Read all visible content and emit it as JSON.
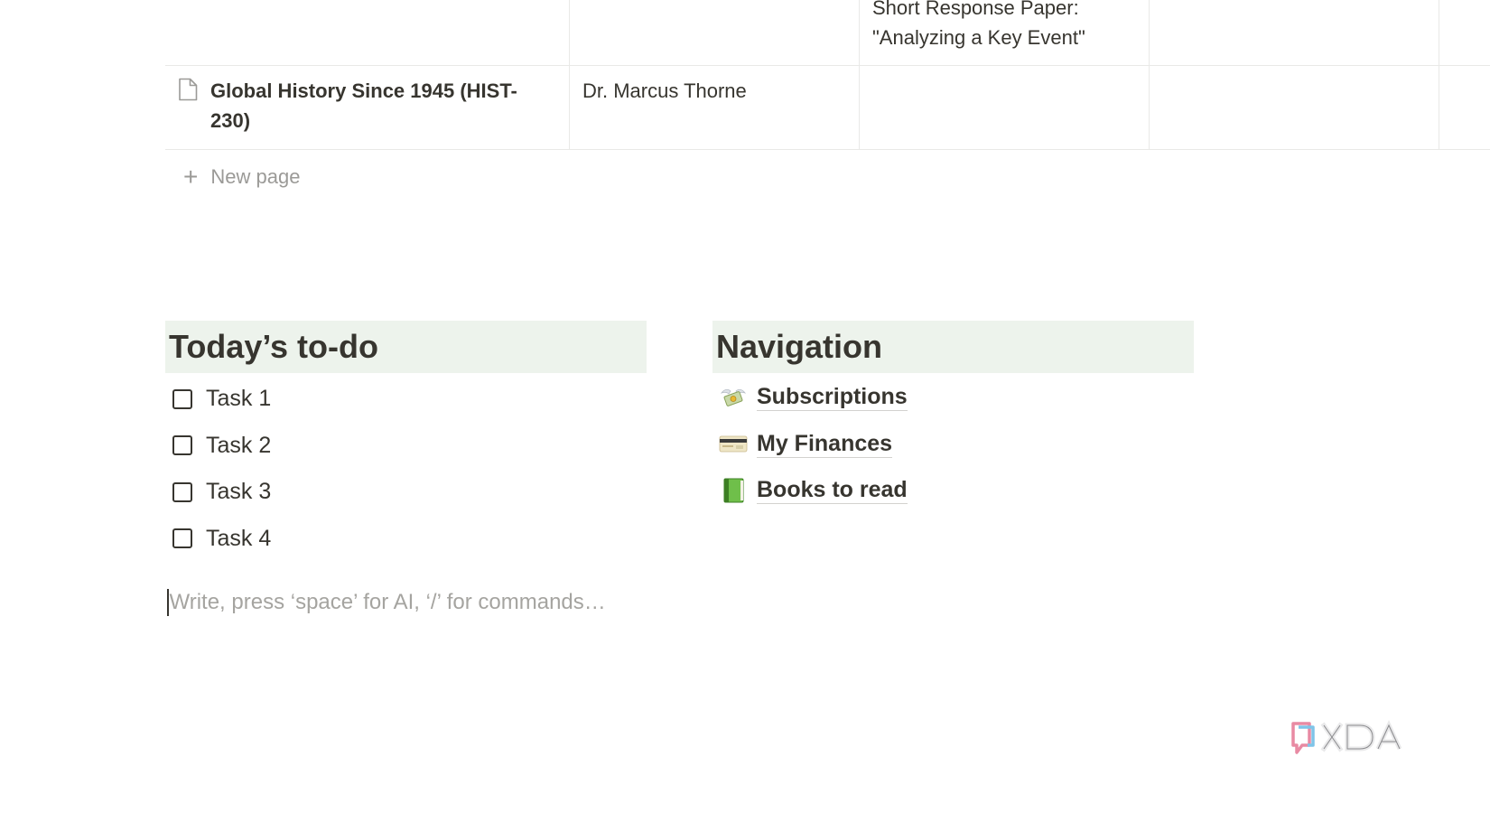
{
  "table": {
    "rows": [
      {
        "title": "",
        "instructor": "",
        "assignment_line1": "Short Response Paper:",
        "assignment_line2": "\"Analyzing a Key Event\""
      },
      {
        "title": "Global History Since 1945 (HIST-230)",
        "instructor": "Dr. Marcus Thorne",
        "assignment_line1": "",
        "assignment_line2": ""
      }
    ],
    "new_page_label": "New page"
  },
  "todo": {
    "heading": "Today’s to-do",
    "items": [
      {
        "label": "Task 1",
        "checked": false
      },
      {
        "label": "Task 2",
        "checked": false
      },
      {
        "label": "Task 3",
        "checked": false
      },
      {
        "label": "Task 4",
        "checked": false
      }
    ]
  },
  "navigation": {
    "heading": "Navigation",
    "links": [
      {
        "label": "Subscriptions",
        "icon": "money-with-wings-icon"
      },
      {
        "label": "My Finances",
        "icon": "credit-card-icon"
      },
      {
        "label": "Books to read",
        "icon": "green-book-icon"
      }
    ]
  },
  "editor": {
    "placeholder": "Write, press ‘space’ for AI, ‘/’ for commands…"
  },
  "colors": {
    "heading_background": "#edf3ec",
    "text": "#37352f",
    "muted_text": "#9b9a97",
    "border": "#e9e9e7"
  }
}
